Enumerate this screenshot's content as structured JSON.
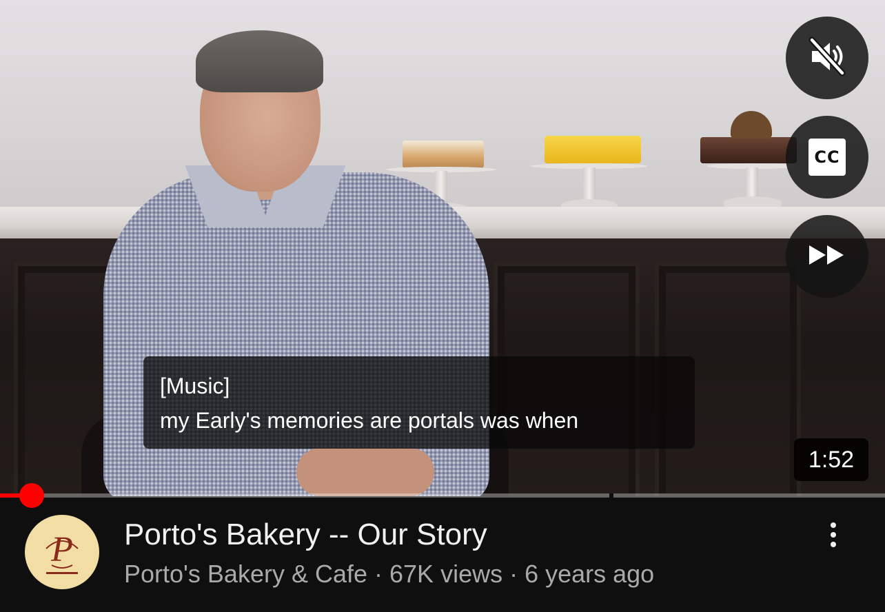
{
  "player": {
    "captions": {
      "line1": "[Music]",
      "line2": "my Early's memories are portals was when"
    },
    "duration": "1:52",
    "progress_fraction": 0.035,
    "controls": {
      "mute_icon": "muted-speaker-icon",
      "cc_label": "CC",
      "forward_icon": "fast-forward-icon"
    }
  },
  "video": {
    "title": "Porto's Bakery -- Our Story",
    "meta": "Porto's Bakery & Cafe · 67K views · 6 years ago",
    "more_icon": "vertical-ellipsis-icon"
  },
  "colors": {
    "progress": "#ff0000",
    "background": "#0f0f0f",
    "title": "#f1f1f1",
    "meta": "#aaaaaa",
    "avatar_bg": "#f2dea4"
  }
}
